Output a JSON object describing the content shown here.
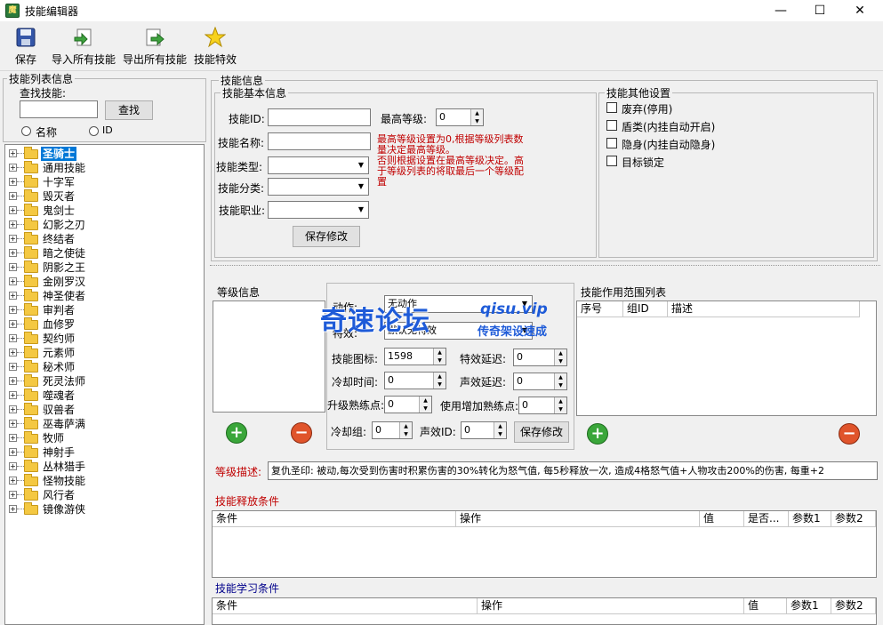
{
  "window": {
    "title": "技能编辑器",
    "minimize": "—",
    "maximize": "☐",
    "close": "✕"
  },
  "toolbar": {
    "save": "保存",
    "import_all": "导入所有技能",
    "export_all": "导出所有技能",
    "effects": "技能特效"
  },
  "skill_list": {
    "group_title": "技能列表信息",
    "search_label": "查找技能:",
    "search_value": "",
    "search_button": "查找",
    "radio_name": "名称",
    "radio_id": "ID",
    "items": [
      "圣骑士",
      "通用技能",
      "十字军",
      "毁灭者",
      "鬼剑士",
      "幻影之刃",
      "终结者",
      "暗之使徒",
      "阴影之王",
      "金刚罗汉",
      "神圣使者",
      "审判者",
      "血修罗",
      "契约师",
      "元素师",
      "秘术师",
      "死灵法师",
      "噬魂者",
      "驭兽者",
      "巫毒萨满",
      "牧师",
      "神射手",
      "丛林猎手",
      "怪物技能",
      "风行者",
      "镜像游侠"
    ]
  },
  "skill_info": {
    "group_title": "技能信息",
    "basic_title": "技能基本信息",
    "id_label": "技能ID:",
    "id_value": "",
    "max_level_label": "最高等级:",
    "max_level_value": "0",
    "name_label": "技能名称:",
    "name_value": "",
    "type_label": "技能类型:",
    "category_label": "技能分类:",
    "job_label": "技能职业:",
    "save_button": "保存修改",
    "note_lines": [
      "最高等级设置为0,根据等级列表数",
      "量决定最高等级。",
      "否则根据设置在最高等级决定。高",
      "于等级列表的将取最后一个等级配",
      "置"
    ],
    "other_title": "技能其他设置",
    "options": [
      "废弃(停用)",
      "盾类(内挂自动开启)",
      "隐身(内挂自动隐身)",
      "目标锁定"
    ]
  },
  "level_info": {
    "group_title": "等级信息",
    "action_label": "动作:",
    "action_value": "无动作",
    "effect_label": "特效:",
    "effect_value": "默认无特效",
    "icon_label": "技能图标:",
    "icon_value": "1598",
    "effect_delay_label": "特效延迟:",
    "effect_delay_value": "0",
    "cooldown_label": "冷却时间:",
    "cooldown_value": "0",
    "sound_delay_label": "声效延迟:",
    "sound_delay_value": "0",
    "upgrade_exp_label": "升级熟练点:",
    "upgrade_exp_value": "0",
    "use_exp_label": "使用增加熟练点:",
    "use_exp_value": "0",
    "cd_group_label": "冷却组:",
    "cd_group_value": "0",
    "sound_id_label": "声效ID:",
    "sound_id_value": "0",
    "save_button": "保存修改",
    "add_symbol": "+",
    "remove_symbol": "−"
  },
  "watermark": {
    "brand": "奇速论坛",
    "site": "qisu.vip",
    "slogan": "传奇架设速成"
  },
  "range_list": {
    "title": "技能作用范围列表",
    "columns": [
      "序号",
      "组ID",
      "描述"
    ],
    "add_symbol": "+",
    "remove_symbol": "−"
  },
  "level_desc": {
    "label": "等级描述:",
    "value": "复仇圣印: 被动,每次受到伤害时积累伤害的30%转化为怒气值, 每5秒释放一次, 造成4格怒气值+人物攻击200%的伤害, 每重+2"
  },
  "release_conditions": {
    "title": "技能释放条件",
    "columns": [
      "条件",
      "操作",
      "值",
      "是否...",
      "参数1",
      "参数2"
    ]
  },
  "learn_conditions": {
    "title": "技能学习条件",
    "columns": [
      "条件",
      "操作",
      "值",
      "参数1",
      "参数2"
    ]
  },
  "colors": {
    "selection": "#0078d7",
    "note_red": "#c00000",
    "section_blue": "#00008b"
  }
}
